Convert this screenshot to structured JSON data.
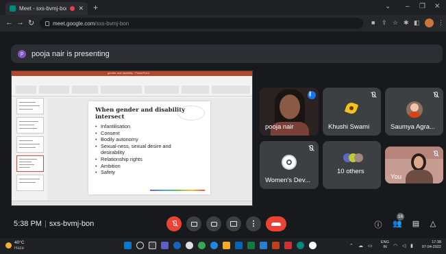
{
  "browser": {
    "tab_title": "Meet - sxs-bvmj-bon",
    "new_tab_label": "+",
    "url_host": "meet.google.com",
    "url_path": "/sxs-bvmj-bon",
    "window_controls": [
      "⌄",
      "–",
      "❐",
      "✕"
    ]
  },
  "banner": {
    "avatar_letter": "p",
    "text": "pooja nair is presenting"
  },
  "presentation": {
    "window_title": "gender and disability - PowerPoint",
    "slide_heading": "When gender and disability intersect",
    "bullets": [
      "Infantilisation",
      "Consent",
      "Bodily autonomy",
      "Sexual-ness, sexual desire and desirability",
      "Relationship rights",
      "Ambition",
      "Safety"
    ]
  },
  "participants": [
    {
      "name": "pooja nair",
      "speaking": true
    },
    {
      "name": "Khushi Swami",
      "muted": true
    },
    {
      "name": "Saumya Agra...",
      "muted": true
    },
    {
      "name": "Women's Dev...",
      "muted": true
    },
    {
      "name": "10 others"
    },
    {
      "name": "You",
      "muted": true
    }
  ],
  "meetbar": {
    "time": "5:38 PM",
    "separator": "|",
    "meeting_code": "sxs-bvmj-bon",
    "more_label": "⋮",
    "participant_count": "16",
    "colors": {
      "danger": "#ea4335",
      "control": "#3c4043"
    }
  },
  "taskbar": {
    "weather_temp": "40°C",
    "weather_desc": "Haze",
    "lang_top": "ENG",
    "lang_bottom": "IN",
    "time": "17:38",
    "date": "07-04-2022"
  }
}
